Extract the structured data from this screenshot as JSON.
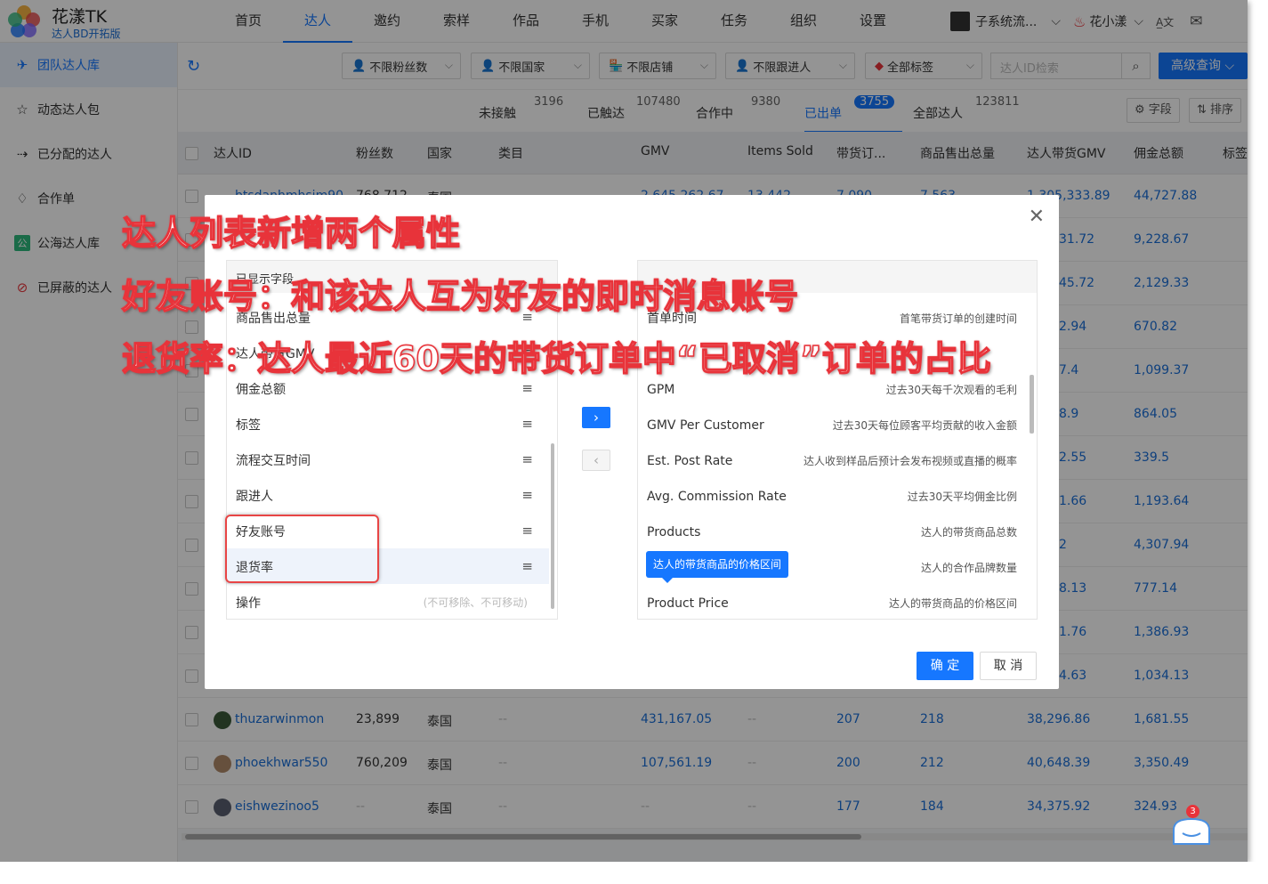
{
  "brand": {
    "name": "花漾TK",
    "subtitle": "达人BD开拓版"
  },
  "nav": [
    "首页",
    "达人",
    "邀约",
    "索样",
    "作品",
    "手机",
    "买家",
    "任务",
    "组织",
    "设置"
  ],
  "user": {
    "subsystem": "子系统流...",
    "name": "花小漾"
  },
  "sidebar": [
    "团队达人库",
    "动态达人包",
    "已分配的达人",
    "合作单",
    "公海达人库",
    "已屏蔽的达人"
  ],
  "filters": [
    "不限粉丝数",
    "不限国家",
    "不限店铺",
    "不限跟进人",
    "全部标签"
  ],
  "search": {
    "placeholder": "达人ID检索"
  },
  "advanced_query": "高级查询",
  "stats": [
    {
      "label": "未接触",
      "count": "3196"
    },
    {
      "label": "已触达",
      "count": "107480"
    },
    {
      "label": "合作中",
      "count": "9380"
    },
    {
      "label": "已出单",
      "count": "3755"
    },
    {
      "label": "全部达人",
      "count": "123811"
    }
  ],
  "tools": {
    "fields": "字段",
    "sort": "排序"
  },
  "columns": [
    "达人ID",
    "粉丝数",
    "国家",
    "类目",
    "GMV",
    "Items Sold",
    "带货订...",
    "商品售出总量",
    "达人带货GMV",
    "佣金总额",
    "标签"
  ],
  "partial_row": {
    "id": "btsdanhmhsim90",
    "fans": "768,712",
    "country": "泰国",
    "gmv": "2,645,262.67",
    "items": "13,442",
    "orders": "7,090",
    "total": "7,563",
    "creator_gmv": "1,305,333.89",
    "commission": "44,727.88"
  },
  "row_fragments": [
    {
      "creator_gmv": "31.72",
      "commission": "9,228.67"
    },
    {
      "creator_gmv": "45.72",
      "commission": "2,129.33"
    },
    {
      "creator_gmv": "2.94",
      "commission": "670.82"
    },
    {
      "creator_gmv": "7.4",
      "commission": "1,099.37"
    },
    {
      "creator_gmv": "8.9",
      "commission": "864.05"
    },
    {
      "creator_gmv": "2.55",
      "commission": "339.5"
    },
    {
      "creator_gmv": "1.66",
      "commission": "1,193.64"
    },
    {
      "creator_gmv": "2",
      "commission": "4,307.94"
    },
    {
      "creator_gmv": "8.13",
      "commission": "777.14"
    },
    {
      "creator_gmv": "1.76",
      "commission": "1,386.93"
    },
    {
      "creator_gmv": "4.63",
      "commission": "1,034.13"
    }
  ],
  "rows": [
    {
      "id": "thuzarwinmon",
      "fans": "23,899",
      "country": "泰国",
      "category": "--",
      "gmv": "431,167.05",
      "items": "--",
      "orders": "207",
      "total": "218",
      "creator_gmv": "38,296.86",
      "commission": "1,681.55"
    },
    {
      "id": "phoekhwar550",
      "fans": "760,209",
      "country": "泰国",
      "category": "--",
      "gmv": "107,561.19",
      "items": "--",
      "orders": "200",
      "total": "212",
      "creator_gmv": "40,648.39",
      "commission": "3,350.49"
    },
    {
      "id": "eishwezinoo5",
      "fans": "--",
      "country": "泰国",
      "category": "--",
      "gmv": "--",
      "items": "--",
      "orders": "177",
      "total": "184",
      "creator_gmv": "34,375.92",
      "commission": "324.93"
    }
  ],
  "modal": {
    "left_header": "已显示字段",
    "left_items": [
      "商品售出总量",
      "达人带货GMV",
      "佣金总额",
      "标签",
      "流程交互时间",
      "跟进人",
      "好友账号",
      "退货率"
    ],
    "fixed_item": "操作",
    "fixed_note": "(不可移除、不可移动)",
    "right_items": [
      {
        "name": "首单时间",
        "desc": "首笔带货订单的创建时间"
      },
      {
        "name": "",
        "desc": ""
      },
      {
        "name": "GPM",
        "desc": "过去30天每千次观看的毛利"
      },
      {
        "name": "GMV Per Customer",
        "desc": "过去30天每位顾客平均贡献的收入金额"
      },
      {
        "name": "Est. Post Rate",
        "desc": "达人收到样品后预计会发布视频或直播的概率"
      },
      {
        "name": "Avg. Commission Rate",
        "desc": "过去30天平均佣金比例"
      },
      {
        "name": "Products",
        "desc": "达人的带货商品总数"
      },
      {
        "name": "",
        "desc": "达人的合作品牌数量"
      },
      {
        "name": "Product Price",
        "desc": "达人的带货商品的价格区间"
      }
    ],
    "tooltip": "达人的带货商品的价格区间",
    "ok": "确 定",
    "cancel": "取 消"
  },
  "annotations": [
    "达人列表新增两个属性",
    "好友账号：和该达人互为好友的即时消息账号",
    "退货率：达人最近60天的带货订单中“已取消”订单的占比"
  ],
  "chat_badge": "3"
}
